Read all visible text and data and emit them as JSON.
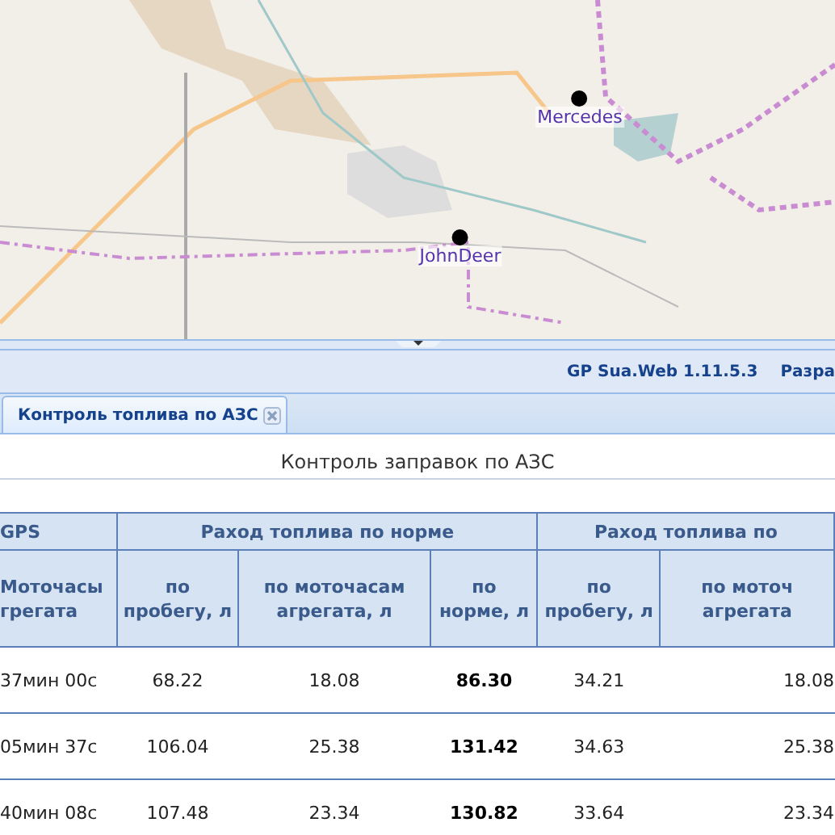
{
  "map": {
    "markers": [
      {
        "label": "Mercedes"
      },
      {
        "label": "JohnDeer"
      }
    ]
  },
  "toolbar": {
    "version": "GP Sua.Web 1.11.5.3",
    "link": "Разра"
  },
  "tabs": [
    {
      "label": "Контроль топлива по АЗС",
      "selected": true
    }
  ],
  "report": {
    "title": "Контроль заправок по АЗС",
    "groups": [
      {
        "label": "GPS"
      },
      {
        "label": "Раход топлива по норме"
      },
      {
        "label": "Раход топлива по"
      }
    ],
    "columns": [
      {
        "label": "Моточасы грегата",
        "bold": false
      },
      {
        "label": "по пробегу, л",
        "bold": false
      },
      {
        "label": "по моточасам агрегата, л",
        "bold": false
      },
      {
        "label": "по норме, л",
        "bold": true
      },
      {
        "label": "по пробегу, л",
        "bold": false
      },
      {
        "label": "по моточ агрегата",
        "bold": false
      }
    ],
    "rows": [
      [
        "37мин 00с",
        "68.22",
        "18.08",
        "86.30",
        "34.21",
        "18.08"
      ],
      [
        "05мин 37с",
        "106.04",
        "25.38",
        "131.42",
        "34.63",
        "25.38"
      ],
      [
        "40мин 08с",
        "107.48",
        "23.34",
        "130.82",
        "33.64",
        "23.34"
      ]
    ]
  }
}
